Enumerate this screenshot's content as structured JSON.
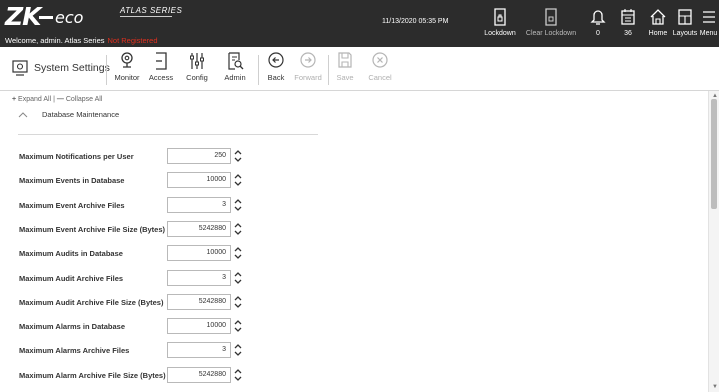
{
  "header": {
    "logo_zk": "ZK",
    "logo_eco": "eco",
    "series": "ATLAS SERIES",
    "welcome": "Welcome, admin.  Atlas Series",
    "registration": "Not Registered",
    "datetime": "11/13/2020 05:35 PM",
    "buttons": [
      {
        "label": "Lockdown",
        "icon": "lockdown-icon"
      },
      {
        "label": "Clear Lockdown",
        "icon": "clear-lockdown-icon"
      },
      {
        "label": "0",
        "icon": "bell-icon"
      },
      {
        "label": "36",
        "icon": "calendar-icon"
      },
      {
        "label": "Home",
        "icon": "home-icon"
      },
      {
        "label": "Layouts",
        "icon": "layouts-icon"
      },
      {
        "label": "Menu",
        "icon": "menu-icon"
      }
    ]
  },
  "toolbar": {
    "title": "System Settings",
    "tools": [
      {
        "label": "Monitor",
        "icon": "monitor-icon"
      },
      {
        "label": "Access",
        "icon": "access-icon"
      },
      {
        "label": "Config",
        "icon": "config-icon"
      },
      {
        "label": "Admin",
        "icon": "admin-icon"
      },
      {
        "label": "Back",
        "icon": "back-icon"
      },
      {
        "label": "Forward",
        "icon": "forward-icon"
      },
      {
        "label": "Save",
        "icon": "save-icon"
      },
      {
        "label": "Cancel",
        "icon": "cancel-icon"
      }
    ]
  },
  "content": {
    "expand_all": "Expand All",
    "collapse_all": "Collapse All",
    "section_title": "Database Maintenance",
    "settings": [
      {
        "label": "Maximum Notifications per User",
        "value": "250"
      },
      {
        "label": "Maximum Events in Database",
        "value": "10000"
      },
      {
        "label": "Maximum Event Archive Files",
        "value": "3"
      },
      {
        "label": "Maximum Event Archive File Size (Bytes)",
        "value": "5242880"
      },
      {
        "label": "Maximum Audits in Database",
        "value": "10000"
      },
      {
        "label": "Maximum Audit Archive Files",
        "value": "3"
      },
      {
        "label": "Maximum Audit Archive File Size (Bytes)",
        "value": "5242880"
      },
      {
        "label": "Maximum Alarms in Database",
        "value": "10000"
      },
      {
        "label": "Maximum Alarms Archive Files",
        "value": "3"
      },
      {
        "label": "Maximum Alarm Archive File Size (Bytes)",
        "value": "5242880"
      }
    ]
  },
  "colors": {
    "header_bg": "#2c2c2c",
    "not_registered": "#e0301e"
  }
}
